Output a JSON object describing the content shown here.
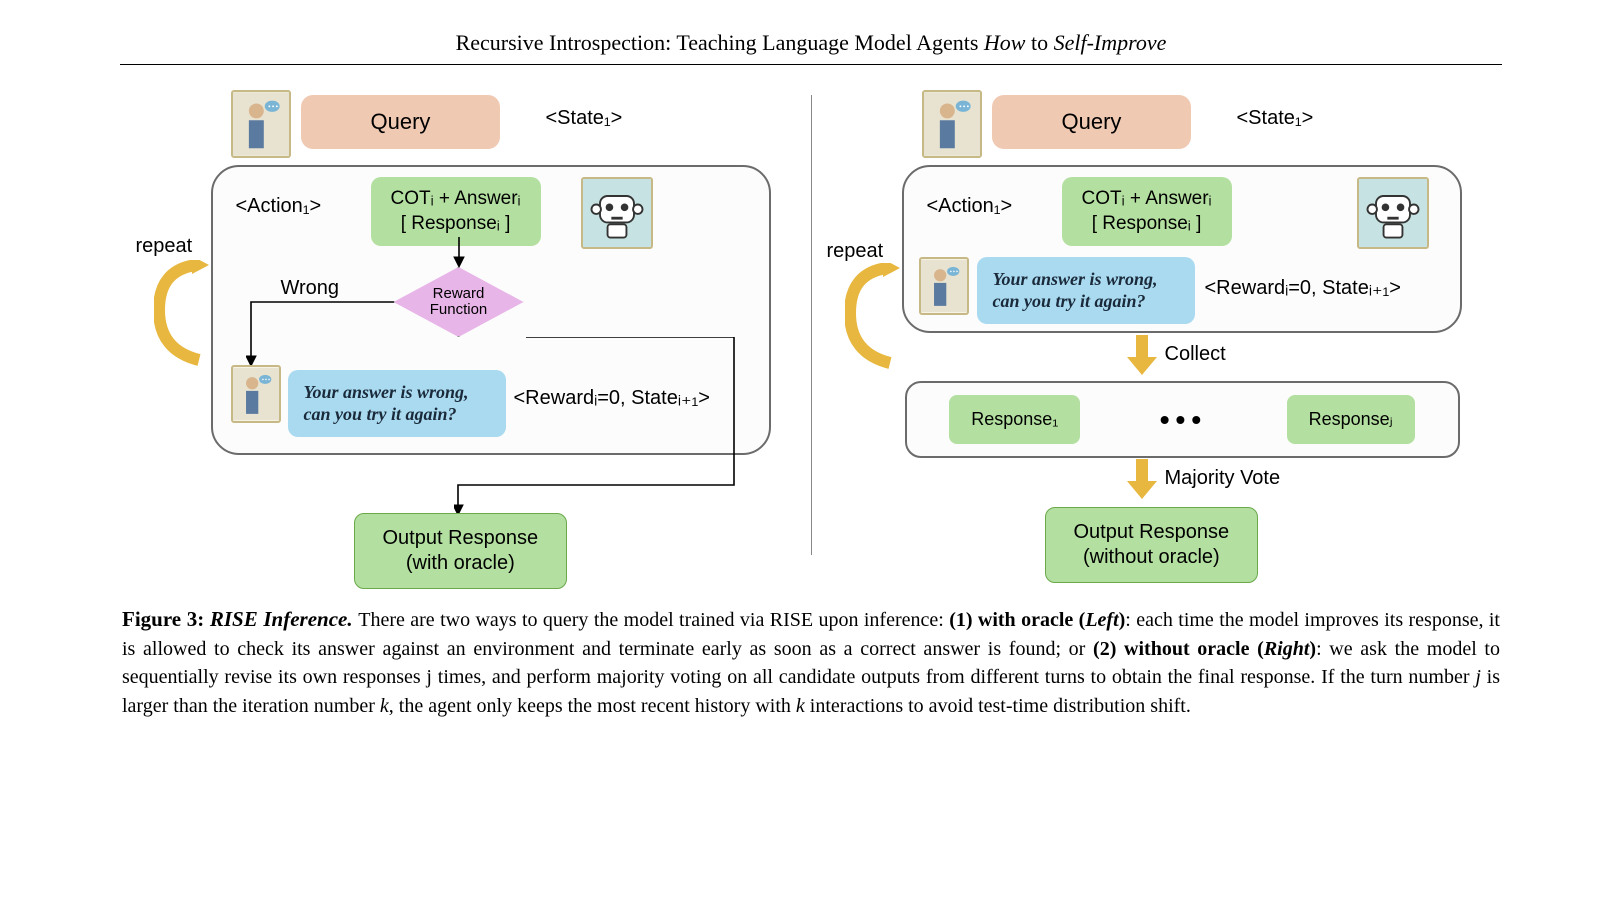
{
  "title": {
    "prefix": "Recursive Introspection: Teaching Language Model Agents ",
    "italic1": "How",
    "mid": " to ",
    "italic2": "Self-Improve"
  },
  "left": {
    "query": "Query",
    "state": "<State₁>",
    "action": "<Action₁>",
    "cot_line1": "COTᵢ + Answerᵢ",
    "cot_line2": "[   Responseᵢ   ]",
    "reward_fn": "Reward\nFunction",
    "wrong": "Wrong",
    "wrong_msg": "Your answer is wrong, can you try it again?",
    "reward_state": "<Rewardᵢ=0, Stateᵢ₊₁>",
    "repeat": "repeat",
    "output_line1": "Output Response",
    "output_line2": "(with oracle)"
  },
  "right": {
    "query": "Query",
    "state": "<State₁>",
    "action": "<Action₁>",
    "cot_line1": "COTᵢ + Answerᵢ",
    "cot_line2": "[   Responseᵢ   ]",
    "wrong_msg": "Your answer is wrong, can you try it again?",
    "reward_state": "<Rewardᵢ=0, Stateᵢ₊₁>",
    "repeat": "repeat",
    "collect": "Collect",
    "resp1": "Response₁",
    "respj": "Responseⱼ",
    "majority": "Majority Vote",
    "output_line1": "Output Response",
    "output_line2": "(without oracle)"
  },
  "caption": {
    "figure_num": "Figure 3:",
    "figure_title": " RISE Inference. ",
    "body_1": "There are two ways to query the model trained via RISE upon inference: ",
    "bold_1": "(1) with oracle (",
    "bold_1_italic": "Left",
    "bold_1_end": ")",
    "body_2": ": each time the model improves its response, it is allowed to check its answer against an environment and terminate early as soon as a correct answer is found; or ",
    "bold_2": "(2) without oracle (",
    "bold_2_italic": "Right",
    "bold_2_end": ")",
    "body_3": ": we ask the model to sequentially revise its own responses j times, and perform majority voting on all candidate outputs from different turns to obtain the final response. If the turn number ",
    "var_j": "j",
    "body_4": " is larger than the iteration number ",
    "var_k": "k",
    "body_5": ", the agent only keeps the most recent history with ",
    "var_k2": "k",
    "body_6": " interactions to avoid test-time distribution shift."
  }
}
